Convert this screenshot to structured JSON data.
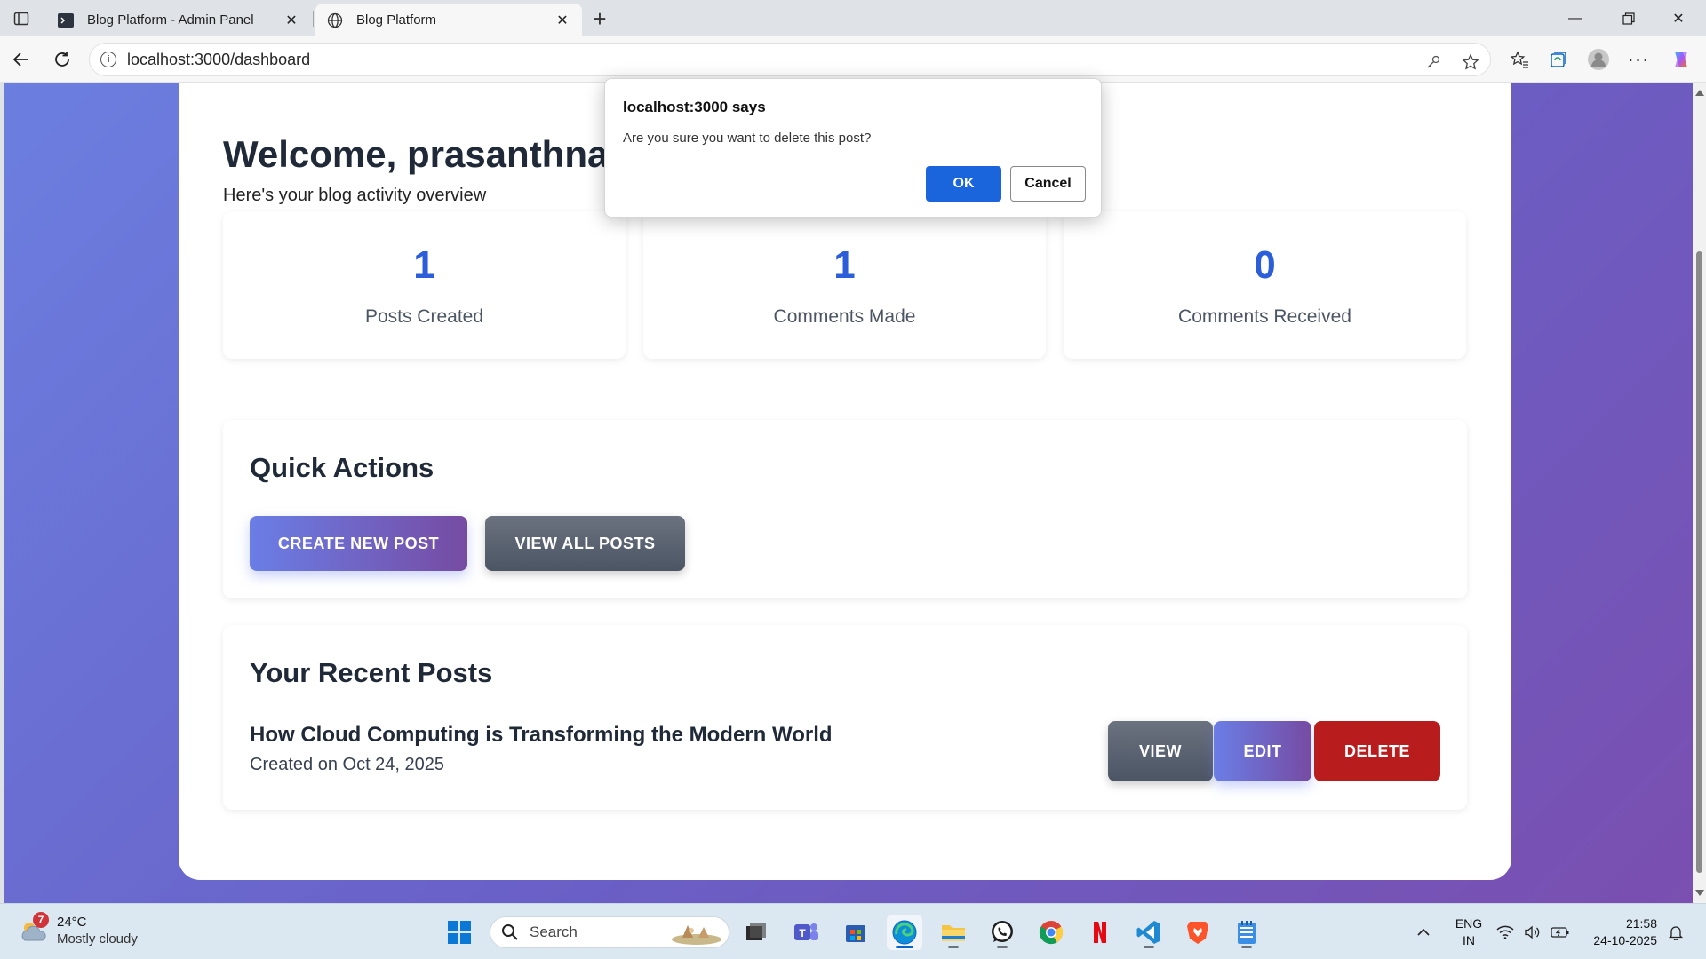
{
  "browser": {
    "tabs": [
      {
        "title": "Blog Platform - Admin Panel",
        "active": false
      },
      {
        "title": "Blog Platform",
        "active": true
      }
    ],
    "url": "localhost:3000/dashboard"
  },
  "page": {
    "welcome": "Welcome, prasanthnag",
    "subtitle": "Here's your blog activity overview",
    "stats": [
      {
        "value": "1",
        "label": "Posts Created"
      },
      {
        "value": "1",
        "label": "Comments Made"
      },
      {
        "value": "0",
        "label": "Comments Received"
      }
    ],
    "quick_actions": {
      "title": "Quick Actions",
      "create_label": "CREATE NEW POST",
      "view_all_label": "VIEW ALL POSTS"
    },
    "recent_posts": {
      "title": "Your Recent Posts",
      "posts": [
        {
          "title": "How Cloud Computing is Transforming the Modern World",
          "date": "Created on Oct 24, 2025",
          "view_label": "VIEW",
          "edit_label": "EDIT",
          "delete_label": "DELETE"
        }
      ]
    }
  },
  "dialog": {
    "title": "localhost:3000 says",
    "message": "Are you sure you want to delete this post?",
    "ok_label": "OK",
    "cancel_label": "Cancel"
  },
  "taskbar": {
    "weather": {
      "temp": "24°C",
      "condition": "Mostly cloudy",
      "badge": "7"
    },
    "search_placeholder": "Search",
    "apps": [
      "file-explorer-icon",
      "teams-icon",
      "store-icon",
      "edge-icon",
      "folder-icon",
      "whatsapp-icon",
      "chrome-icon",
      "netflix-icon",
      "vscode-icon",
      "brave-icon",
      "notepad-icon"
    ],
    "lang_line1": "ENG",
    "lang_line2": "IN",
    "time": "21:58",
    "date": "24-10-2025"
  },
  "colors": {
    "accent_blue": "#2b5ed8",
    "gradient_start": "#6a7ee6",
    "gradient_end": "#764ba2",
    "delete_red": "#b91c1c",
    "dialog_ok": "#1a64dc"
  }
}
